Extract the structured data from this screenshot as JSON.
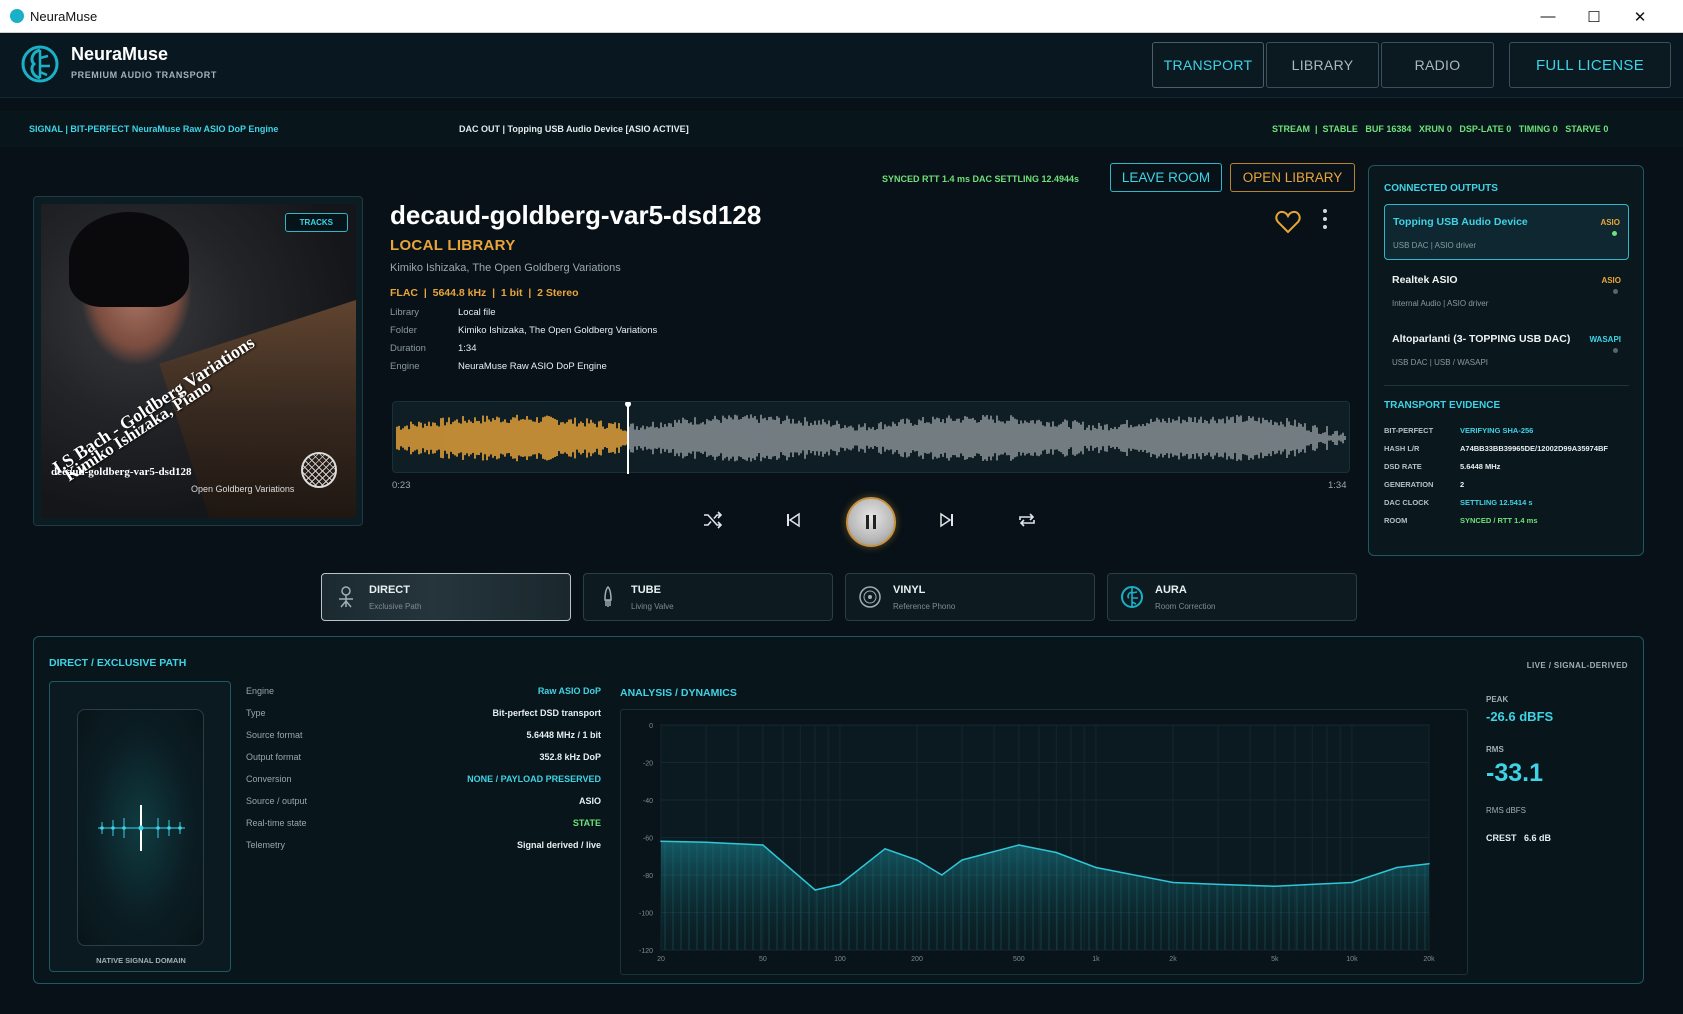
{
  "window": {
    "title": "NeuraMuse",
    "minimize": "—",
    "maximize": "☐",
    "close": "✕"
  },
  "header": {
    "brand": "NeuraMuse",
    "tagline": "PREMIUM AUDIO TRANSPORT",
    "nav": {
      "transport": "TRANSPORT",
      "library": "LIBRARY",
      "radio": "RADIO",
      "license": "FULL LICENSE"
    }
  },
  "signal_strip": {
    "signal": "SIGNAL  |  BIT-PERFECT NeuraMuse Raw ASIO DoP Engine",
    "dac_out": "DAC OUT  |  Topping USB Audio Device  [ASIO ACTIVE]",
    "stats": "STREAM  |  STABLE   BUF 16384   XRUN 0   DSP-LATE 0   TIMING 0   STARVE 0"
  },
  "player": {
    "sync_status": "SYNCED  RTT 1.4 ms  DAC SETTLING 12.4944s",
    "leave_room": "LEAVE ROOM",
    "open_library": "OPEN LIBRARY",
    "album_art": {
      "tracks_tag": "TRACKS",
      "title": "J.S Bach - Goldberg Variations",
      "subtitle": "Kimiko Ishizaka, Piano",
      "file": "decaud-goldberg-var5-dsd128",
      "label": "Open Goldberg Variations"
    },
    "track_title": "decaud-goldberg-var5-dsd128",
    "source": "LOCAL LIBRARY",
    "artist": "Kimiko Ishizaka, The Open Goldberg Variations",
    "format": "FLAC  |  5644.8 kHz  |  1 bit  |  2 Stereo",
    "meta": [
      {
        "key": "Library",
        "value": "Local file"
      },
      {
        "key": "Folder",
        "value": "Kimiko Ishizaka, The Open Goldberg Variations"
      },
      {
        "key": "Duration",
        "value": "1:34"
      },
      {
        "key": "Engine",
        "value": "NeuraMuse Raw ASIO DoP Engine"
      }
    ],
    "elapsed": "0:23",
    "duration": "1:34",
    "progress": 0.245
  },
  "modes": [
    {
      "name": "DIRECT",
      "sub": "Exclusive Path"
    },
    {
      "name": "TUBE",
      "sub": "Living Valve"
    },
    {
      "name": "VINYL",
      "sub": "Reference Phono"
    },
    {
      "name": "AURA",
      "sub": "Room Correction"
    }
  ],
  "outputs": {
    "heading": "CONNECTED OUTPUTS",
    "items": [
      {
        "name": "Topping USB Audio Device",
        "sub": "USB DAC  |  ASIO driver",
        "api": "ASIO"
      },
      {
        "name": "Realtek ASIO",
        "sub": "Internal Audio  |  ASIO driver",
        "api": "ASIO"
      },
      {
        "name": "Altoparlanti (3- TOPPING USB DAC)",
        "sub": "USB DAC  |  USB / WASAPI",
        "api": "WASAPI"
      }
    ],
    "evidence_heading": "TRANSPORT EVIDENCE",
    "evidence": [
      {
        "key": "BIT-PERFECT",
        "value": "VERIFYING SHA-256"
      },
      {
        "key": "HASH L/R",
        "value": "A74BB33BB39965DE/12002D99A35974BF"
      },
      {
        "key": "DSD RATE",
        "value": "5.6448 MHz"
      },
      {
        "key": "GENERATION",
        "value": "2"
      },
      {
        "key": "DAC CLOCK",
        "value": "SETTLING 12.5414 s"
      },
      {
        "key": "ROOM",
        "value": "SYNCED / RTT 1.4 ms"
      }
    ]
  },
  "path_panel": {
    "title": "DIRECT / EXCLUSIVE PATH",
    "live": "LIVE / SIGNAL-DERIVED",
    "native_label": "NATIVE SIGNAL DOMAIN",
    "specs": [
      {
        "key": "Engine",
        "value": "Raw ASIO DoP"
      },
      {
        "key": "Type",
        "value": "Bit-perfect DSD transport"
      },
      {
        "key": "Source format",
        "value": "5.6448 MHz / 1 bit"
      },
      {
        "key": "Output format",
        "value": "352.8 kHz DoP"
      },
      {
        "key": "Conversion",
        "value": "NONE / PAYLOAD PRESERVED"
      },
      {
        "key": "Source / output",
        "value": "ASIO"
      },
      {
        "key": "Real-time state",
        "value": "STATE"
      },
      {
        "key": "Telemetry",
        "value": "Signal derived / live"
      }
    ],
    "analysis_title": "ANALYSIS / DYNAMICS",
    "peak_label": "PEAK",
    "peak_value": "-26.6 dBFS",
    "rms_label": "RMS",
    "rms_value": "-33.1",
    "rms_unit": "RMS dBFS",
    "crest": "CREST   6.6 dB"
  },
  "chart_data": {
    "type": "area",
    "x": [
      20,
      30,
      35,
      50,
      80,
      100,
      150,
      200,
      250,
      300,
      500,
      700,
      1000,
      2000,
      3000,
      5000,
      7000,
      10000,
      15000,
      20000
    ],
    "series": [
      {
        "values": [
          -62,
          -62.5,
          -63,
          -64,
          -88,
          -85,
          -66,
          -72,
          -80,
          -72,
          -64,
          -68,
          -76,
          -84,
          -85,
          -86,
          -85,
          -84,
          -76,
          -74
        ]
      }
    ],
    "x_ticks": [
      "20",
      "50",
      "100",
      "200",
      "500",
      "1k",
      "2k",
      "5k",
      "10k",
      "20k"
    ],
    "y_ticks": [
      "0",
      "-20",
      "-40",
      "-60",
      "-80",
      "-100",
      "-120"
    ],
    "ylim": [
      -120,
      0
    ],
    "xscale": "log",
    "grid": true
  },
  "colors": {
    "accent": "#3fd3e6",
    "orange": "#e9a53a",
    "green": "#6fe07a"
  }
}
